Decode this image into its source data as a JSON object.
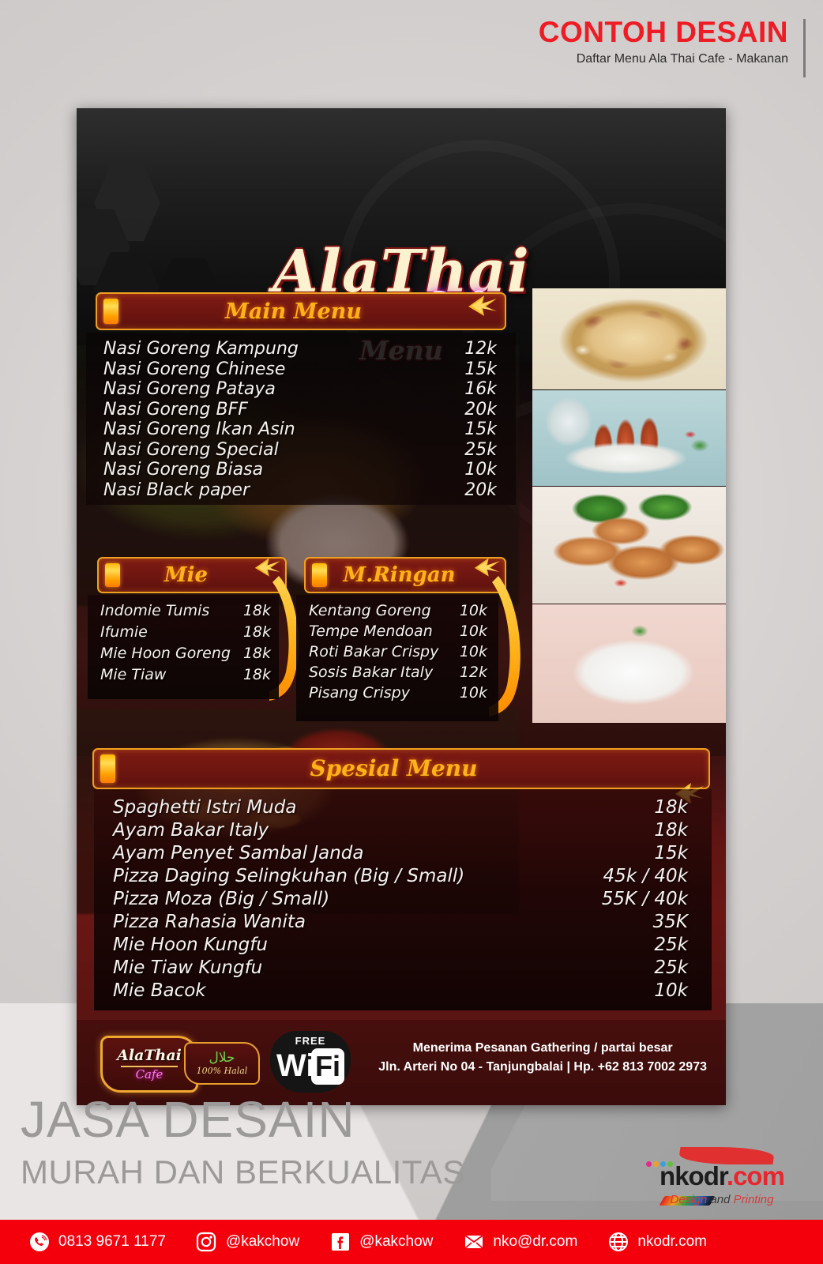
{
  "top_header": {
    "title": "CONTOH DESAIN",
    "subtitle": "Daftar Menu Ala Thai Cafe - Makanan"
  },
  "watermark": {
    "line1": "JASA DESAIN",
    "line2": "MURAH DAN BERKUALITAS"
  },
  "poster": {
    "brand_name": "AlaThai",
    "brand_sub": "Cafe",
    "brand_menu": "Menu",
    "sections": [
      {
        "id": "main-menu",
        "title": "Main Menu",
        "items": [
          {
            "name": "Nasi Goreng Kampung",
            "price": "12k"
          },
          {
            "name": "Nasi Goreng Chinese",
            "price": "15k"
          },
          {
            "name": "Nasi Goreng Pataya",
            "price": "16k"
          },
          {
            "name": "Nasi Goreng BFF",
            "price": "20k"
          },
          {
            "name": "Nasi Goreng Ikan Asin",
            "price": "15k"
          },
          {
            "name": "Nasi Goreng Special",
            "price": "25k"
          },
          {
            "name": "Nasi Goreng Biasa",
            "price": "10k"
          },
          {
            "name": "Nasi Black paper",
            "price": "20k"
          }
        ]
      },
      {
        "id": "mie",
        "title": "Mie",
        "items": [
          {
            "name": "Indomie Tumis",
            "price": "18k"
          },
          {
            "name": "Ifumie",
            "price": "18k"
          },
          {
            "name": "Mie Hoon Goreng",
            "price": "18k"
          },
          {
            "name": "Mie Tiaw",
            "price": "18k"
          }
        ]
      },
      {
        "id": "m-ringan",
        "title": "M.Ringan",
        "items": [
          {
            "name": "Kentang Goreng",
            "price": "10k"
          },
          {
            "name": "Tempe Mendoan",
            "price": "10k"
          },
          {
            "name": "Roti Bakar Crispy",
            "price": "10k"
          },
          {
            "name": "Sosis Bakar Italy",
            "price": "12k"
          },
          {
            "name": "Pisang Crispy",
            "price": "10k"
          }
        ]
      },
      {
        "id": "spesial-menu",
        "title": "Spesial Menu",
        "items": [
          {
            "name": "Spaghetti Istri Muda",
            "price": "18k"
          },
          {
            "name": "Ayam Bakar Italy",
            "price": "18k"
          },
          {
            "name": "Ayam Penyet Sambal Janda",
            "price": "15k"
          },
          {
            "name": "Pizza Daging Selingkuhan (Big / Small)",
            "price": "45k / 40k"
          },
          {
            "name": "Pizza Moza (Big / Small)",
            "price": "55K / 40k"
          },
          {
            "name": "Pizza Rahasia Wanita",
            "price": "35K"
          },
          {
            "name": "Mie Hoon Kungfu",
            "price": "25k"
          },
          {
            "name": "Mie Tiaw Kungfu",
            "price": "25k"
          },
          {
            "name": "Mie Bacok",
            "price": "10k"
          }
        ]
      }
    ],
    "photos": [
      {
        "name": "pizza-photo"
      },
      {
        "name": "sausage-photo"
      },
      {
        "name": "grilled-chicken-photo"
      },
      {
        "name": "spaghetti-photo"
      }
    ],
    "footer": {
      "logo_name": "AlaThai",
      "logo_sub": "Cafe",
      "halal_arabic": "حلال",
      "halal_text": "100% Halal",
      "wifi_free": "FREE",
      "wifi_wi": "Wi",
      "wifi_fi": "Fi",
      "address_line1": "Menerima Pesanan Gathering / partai besar",
      "address_line2": "Jln. Arteri No 04  - Tanjungbalai | Hp. +62 813 7002 2973"
    }
  },
  "nkodr": {
    "word_black": "nkodr",
    "word_red": ".com",
    "tag_design": "Design",
    "tag_and": "and",
    "tag_printing": "Printing"
  },
  "contact_bar": {
    "items": [
      {
        "icon": "phone-icon",
        "text": "0813 9671 1177"
      },
      {
        "icon": "instagram-icon",
        "text": "@kakchow"
      },
      {
        "icon": "facebook-icon",
        "text": "@kakchow"
      },
      {
        "icon": "email-icon",
        "text": "nko@dr.com"
      },
      {
        "icon": "globe-icon",
        "text": "nkodr.com"
      }
    ]
  },
  "colors": {
    "accent_red": "#ed1c24",
    "bar_red": "#f4000d",
    "gold": "#ffb21a",
    "panel_maroon": "#701611"
  }
}
